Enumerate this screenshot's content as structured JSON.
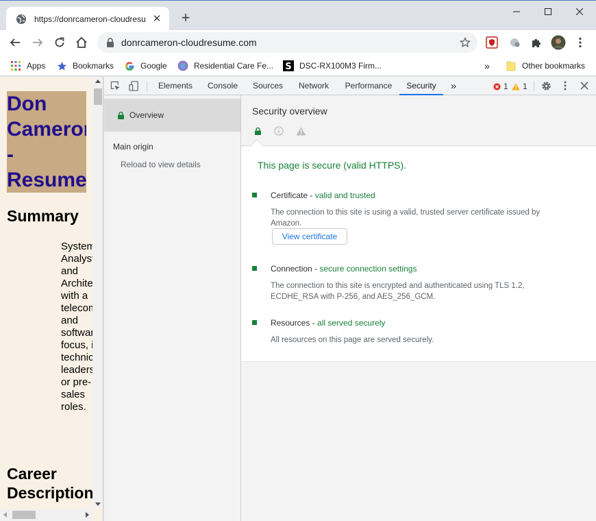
{
  "browser": {
    "tab_title": "https://donrcameron-cloudresu",
    "url": "donrcameron-cloudresume.com",
    "bookmarks": [
      {
        "label": "Apps",
        "icon": "apps-grid-icon"
      },
      {
        "label": "Bookmarks",
        "icon": "star-icon"
      },
      {
        "label": "Google",
        "icon": "google-icon"
      },
      {
        "label": "Residential Care Fe...",
        "icon": "site-icon"
      },
      {
        "label": "DSC-RX100M3 Firm...",
        "icon": "sony-icon"
      }
    ],
    "other_bookmarks": "Other bookmarks",
    "overflow": "»"
  },
  "page": {
    "title": "Don\nCameron\n-\nResume",
    "summary_heading": "Summary",
    "summary_text": "Systems Analyst and Architect with a telecom and software focus, in technical leadership or pre-sales roles.",
    "career_heading": "Career Description"
  },
  "devtools": {
    "tabs": [
      "Elements",
      "Console",
      "Sources",
      "Network",
      "Performance",
      "Security"
    ],
    "active_tab": "Security",
    "more": "»",
    "error_count": "1",
    "warning_count": "1",
    "sidebar": {
      "overview": "Overview",
      "main_origin": "Main origin",
      "reload": "Reload to view details"
    },
    "security": {
      "title": "Security overview",
      "secure_message": "This page is secure (valid HTTPS).",
      "items": [
        {
          "label": "Certificate - ",
          "highlight": "valid and trusted",
          "description": "The connection to this site is using a valid, trusted server certificate issued by Amazon."
        },
        {
          "label": "Connection - ",
          "highlight": "secure connection settings",
          "description": "The connection to this site is encrypted and authenticated using TLS 1.2, ECDHE_RSA with P-256, and AES_256_GCM."
        },
        {
          "label": "Resources - ",
          "highlight": "all served securely",
          "description": "All resources on this page are served securely."
        }
      ],
      "view_certificate": "View certificate"
    }
  },
  "colors": {
    "secure_green": "#188038",
    "active_tab_blue": "#1a73e8",
    "resume_title_bg": "#c8aa84",
    "resume_title_text": "#200f8d",
    "page_bg": "#f9f1e5"
  }
}
